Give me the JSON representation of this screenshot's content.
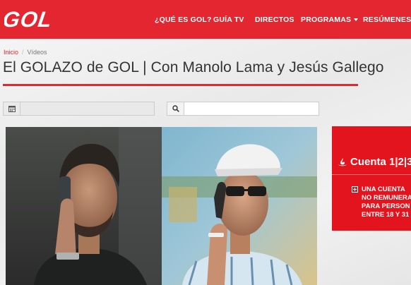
{
  "header": {
    "logo_text": "GOL",
    "nav": [
      {
        "label": "¿QUÉ ES GOL?",
        "dropdown": false
      },
      {
        "label": "GUÍA TV",
        "dropdown": false
      },
      {
        "label": "DIRECTOS",
        "dropdown": false
      },
      {
        "label": "PROGRAMAS",
        "dropdown": true
      },
      {
        "label": "RESÚMENES",
        "dropdown": true
      }
    ]
  },
  "breadcrumb": {
    "home": "Inicio",
    "current": "Vídeos"
  },
  "page": {
    "title": "El GOLAZO de GOL | Con Manolo Lama y Jesús Gallego"
  },
  "filters": {
    "date_icon": "calendar-icon",
    "date_value": "",
    "search_icon": "search-icon",
    "search_value": ""
  },
  "ad": {
    "brand": "Cuenta 1|2|3",
    "lines": [
      "UNA CUENTA",
      "NO REMUNERA",
      "PARA PERSON",
      "ENTRE 18 Y 31"
    ]
  },
  "colors": {
    "brand_red": "#e32630",
    "ad_red": "#e4141e"
  }
}
